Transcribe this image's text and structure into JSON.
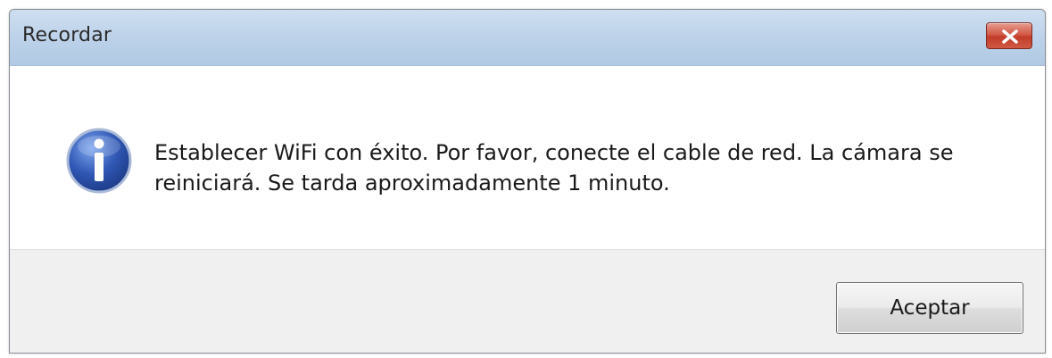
{
  "dialog": {
    "title": "Recordar",
    "close_icon": "close-icon",
    "info_icon": "info-icon",
    "message": "Establecer WiFi con éxito. Por favor, conecte el cable de red. La cámara se reiniciará. Se tarda aproximadamente 1 minuto.",
    "ok_label": "Aceptar"
  },
  "colors": {
    "titlebar": "#bed3ea",
    "close_button": "#c23c2a",
    "footer": "#f0f0f0",
    "info_icon": "#2f57b4"
  }
}
